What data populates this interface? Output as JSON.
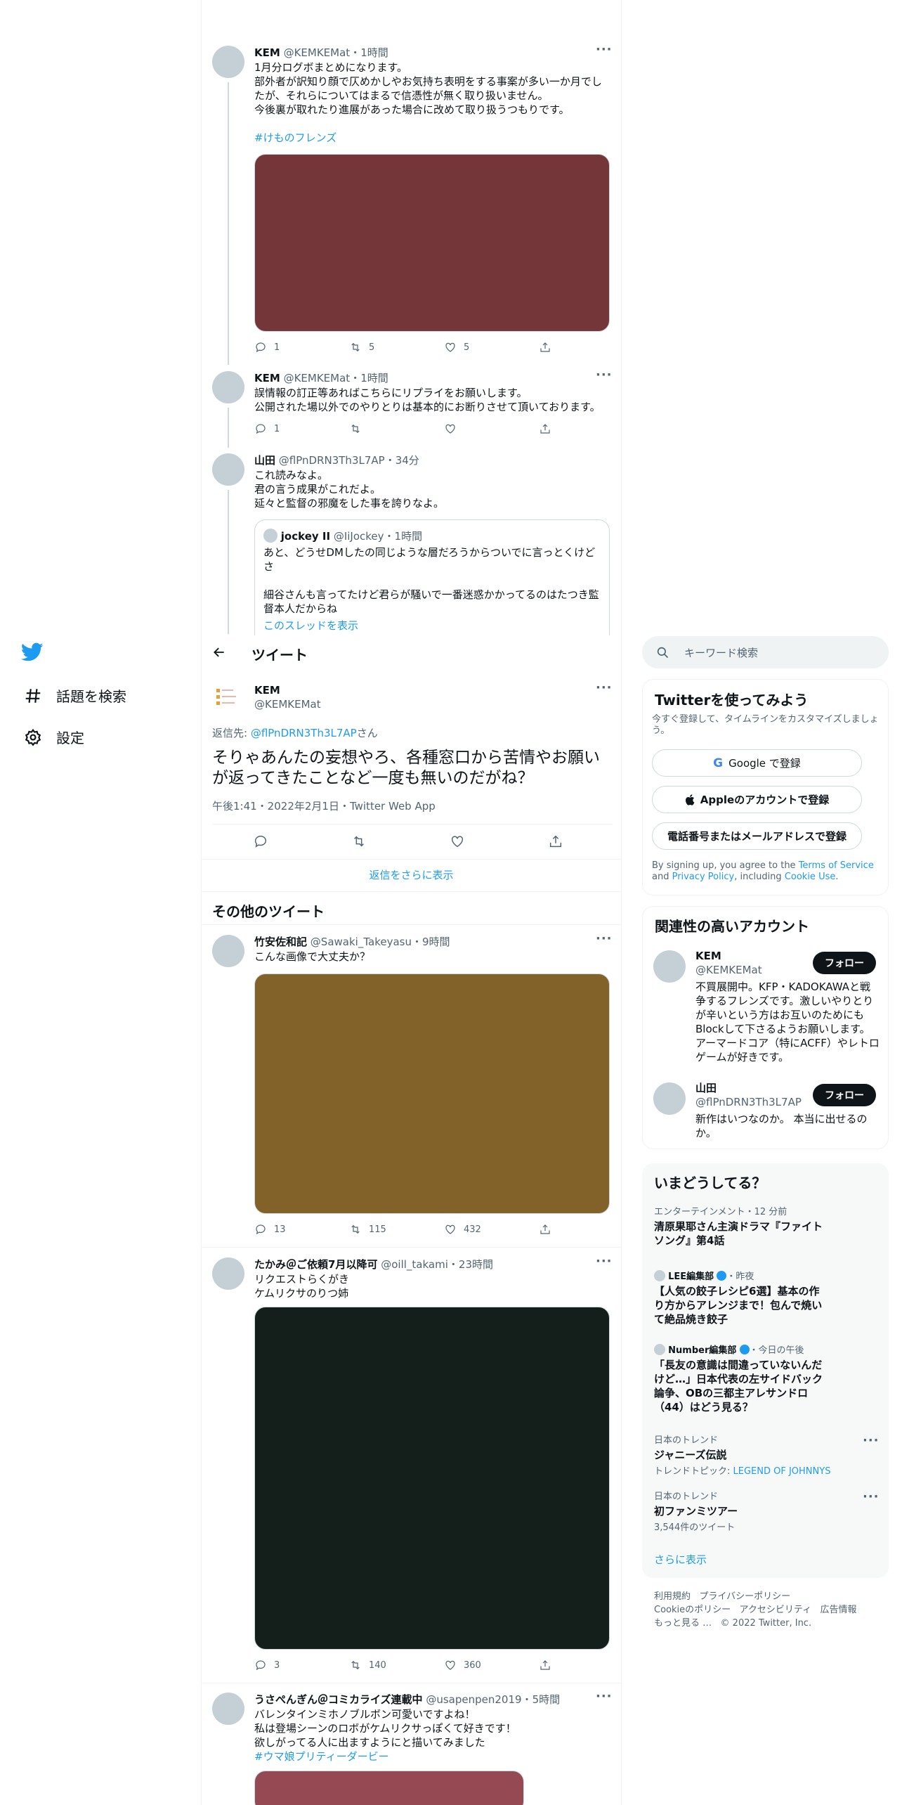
{
  "search": {
    "placeholder": "キーワード検索"
  },
  "nav": {
    "explore": "話題を検索",
    "settings": "設定"
  },
  "header": {
    "title": "ツイート"
  },
  "thread": [
    {
      "name": "KEM",
      "handle": "@KEMKEMat",
      "time": "1時間",
      "lines": [
        "1月分ログボまとめになります。",
        "部外者が訳知り顔で仄めかしやお気持ち表明をする事案が多い一か月でしたが、それらについてはまるで信憑性が無く取り扱いません。",
        "今後裏が取れたり進展があった場合に改めて取り扱うつもりです。"
      ],
      "hashtag": "#けものフレンズ",
      "media_color": "#743638",
      "reply": "1",
      "retweet": "5",
      "like": "5"
    },
    {
      "name": "KEM",
      "handle": "@KEMKEMat",
      "time": "1時間",
      "lines": [
        "誤情報の訂正等あればこちらにリプライをお願いします。",
        "公開された場以外でのやりとりは基本的にお断りさせて頂いております。"
      ],
      "reply": "1",
      "retweet": "",
      "like": ""
    },
    {
      "name": "山田",
      "handle": "@flPnDRN3Th3L7AP",
      "time": "34分",
      "lines": [
        "これ読みなよ。",
        "君の言う成果がこれだよ。",
        "延々と監督の邪魔をした事を誇りなよ。"
      ],
      "quote": {
        "name": "jockey II",
        "handle": "@IiJockey",
        "time": "1時間",
        "text1": "あと、どうせDMしたの同じような層だろうからついでに言っとくけどさ",
        "text2": "細谷さんも言ってたけど君らが騒いで一番迷惑かかってるのはたつき監督本人だからね",
        "show_thread": "このスレッドを表示"
      }
    }
  ],
  "main_tweet": {
    "name": "KEM",
    "handle": "@KEMKEMat",
    "reply_to_label": "返信先: ",
    "reply_to_handle": "@flPnDRN3Th3L7AP",
    "reply_to_suffix": "さん",
    "text": "そりゃあんたの妄想やろ、各種窓口から苦情やお願いが返ってきたことなど一度も無いのだがね？",
    "meta": "午後1:41・2022年2月1日・Twitter Web App",
    "more_replies": "返信をさらに表示"
  },
  "more_tweets": {
    "heading": "その他のツイート",
    "items": [
      {
        "name": "竹安佐和記",
        "handle": "@Sawaki_Takeyasu",
        "time": "9時間",
        "lines": [
          "こんな画像で大丈夫か？"
        ],
        "hashtag": "",
        "media_color": "#826229",
        "reply": "13",
        "retweet": "115",
        "like": "432"
      },
      {
        "name": "たかみ＠ご依頼7月以降可",
        "handle": "@oill_takami",
        "time": "23時間",
        "lines": [
          "リクエストらくがき",
          "ケムリクサのりつ姉"
        ],
        "hashtag": "",
        "media_color": "#141f1b",
        "reply": "3",
        "retweet": "140",
        "like": "360"
      },
      {
        "name": "うさぺんぎん＠コミカライズ連載中",
        "handle": "@usapenpen2019",
        "time": "5時間",
        "lines": [
          "バレンタインミホノブルボン可愛いですよね！",
          "私は登場シーンのロボがケムリクサっぽくて好きです！",
          "欲しがってる人に出ますようにと描いてみました"
        ],
        "hashtag": "#ウマ娘プリティーダービー",
        "media_color": "#954a53"
      }
    ]
  },
  "signup": {
    "title": "Twitterを使ってみよう",
    "sub": "今すぐ登録して、タイムラインをカスタマイズしましょう。",
    "google": "Google で登録",
    "apple": "Appleのアカウントで登録",
    "phone": "電話番号またはメールアドレスで登録",
    "legal1": "By signing up, you agree to the ",
    "terms": "Terms of Service",
    "legal2": " and ",
    "privacy": "Privacy Policy",
    "legal3": ", including ",
    "cookie": "Cookie Use",
    "legal4": "."
  },
  "related": {
    "title": "関連性の高いアカウント",
    "follow": "フォロー",
    "accounts": [
      {
        "name": "KEM",
        "handle": "@KEMKEMat",
        "bio": "不買展開中。KFP・KADOKAWAと戦争するフレンズです。激しいやりとりが辛いという方はお互いのためにもBlockして下さるようお願いします。アーマードコア（特にACFF）やレトロゲームが好きです。"
      },
      {
        "name": "山田",
        "handle": "@flPnDRN3Th3L7AP",
        "bio": "新作はいつなのか。 本当に出せるのか。"
      }
    ]
  },
  "trends": {
    "title": "いまどうしてる？",
    "items": [
      {
        "context": "エンターテインメント・12 分前",
        "title": "清原果耶さん主演ドラマ『ファイトソング』第4話",
        "source": ""
      },
      {
        "source": "LEE編集部",
        "time": "・昨夜",
        "title": "【人気の餃子レシピ6選】基本の作り方からアレンジまで！包んで焼いて絶品焼き餃子"
      },
      {
        "source": "Number編集部",
        "time": "・今日の午後",
        "title": "「長友の意識は間違っていないんだけど…」日本代表の左サイドバック論争、OBの三都主アレサンドロ（44）はどう見る？"
      },
      {
        "context": "日本のトレンド",
        "title": "ジャニーズ伝説",
        "sub_label": "トレンドトピック: ",
        "sub_link": "LEGEND OF JOHNNYS"
      },
      {
        "context": "日本のトレンド",
        "title": "初ファンミツアー",
        "count": "3,544件のツイート"
      }
    ],
    "show_more": "さらに表示"
  },
  "footer": {
    "row1": [
      "利用規約",
      "プライバシーポリシー"
    ],
    "row2": [
      "Cookieのポリシー",
      "アクセシビリティ",
      "広告情報"
    ],
    "more": "もっと見る …",
    "copyright": "© 2022 Twitter, Inc."
  },
  "colors": {
    "accent": "#1d9bf0",
    "text": "#0f1419",
    "muted": "#536471"
  }
}
